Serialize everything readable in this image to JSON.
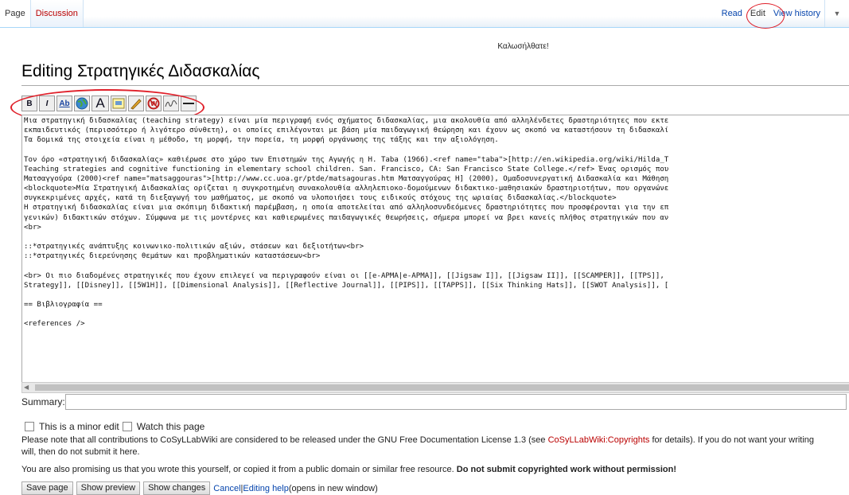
{
  "tabs": {
    "left": [
      "Page",
      "Discussion"
    ],
    "right": [
      "Read",
      "Edit",
      "View history"
    ]
  },
  "sitenotice": "Καλωσήλθατε!",
  "title": "Editing Στρατηγικές Διδασκαλίας",
  "toolbar": {
    "bold": "B",
    "italic": "I",
    "internal_link": "Ab",
    "headline": "A"
  },
  "editor_text": "Μια στρατηγική διδασκαλίας (teaching strategy) είναι μία περιγραφή ενός σχήματος διδασκαλίας, μια ακολουθία από αλληλένδετες δραστηριότητες που εκτε\nεκπαιδευτικός (περισσότερο ή λιγότερο σύνθετη), οι οποίες επιλέγονται με βάση μία παιδαγωγική θεώρηση και έχουν ως σκοπό να καταστήσουν τη διδασκαλί\nΤα δομικά της στοιχεία είναι η μέθοδο, τη μορφή, την πορεία, τη μορφή οργάνωσης της τάξης και την αξιολόγηση.\n\nΤον όρο «στρατηγική διδασκαλίας» καθιέρωσε στο χώρο των Επιστημών της Αγωγής η H. Taba (1966).<ref name=\"taba\">[http://en.wikipedia.org/wiki/Hilda_T\nTeaching strategies and cognitive functioning in elementary school children. San. Francisco, CA: San Francisco State College.</ref> Ένας ορισμός που\nΜατσαγγούρα (2000)<ref name=\"matsaggouras\">[http://www.cc.uoa.gr/ptde/matsagouras.htm Ματσαγγούρας Η] (2000), Ομαδοσυνεργατική Διδασκαλία και Μάθηση\n<blockquote>Μία Στρατηγική Διδασκαλίας ορίζεται η συγκροτημένη συνακολουθία αλληλεπιοκο-δομούμενων διδακτικο-μαθησιακών δραστηριοτήτων, που οργανώνε\nσυγκεκριμένες αρχές, κατά τη διεξαγωγή του μαθήματος, με σκοπό να υλοποιήσει τους ειδικούς στόχους της ωριαίας διδασκαλίας.</blockquote>\nΗ στρατηγική διδασκαλίας είναι μια σκόπιμη διδακτική παρέμβαση, η οποία αποτελείται από αλληλοσυνδεόμενες δραστηριότητες που προσφέρονται για την επ\nγενικών) διδακτικών στόχων. Σύμφωνα με τις μοντέρνες και καθιερωμένες παιδαγωγικές θεωρήσεις, σήμερα μπορεί να βρει κανείς πλήθος στρατηγικών που αν\n<br>\n\n::*στρατηγικές ανάπτυξης κοινωνικο-πολιτικών αξιών, στάσεων και δεξιοτήτων<br>\n::*στρατηγικές διερεύνησης θεμάτων και προβληματικών καταστάσεων<br>\n\n<br> Οι πιο διαδομένες στρατηγικές που έχουν επιλεγεί να περιγραφούν είναι οι [[e-APMA|e-APMA]], [[Jigsaw I]], [[Jigsaw II]], [[SCAMPER]], [[TPS]],\nStrategy]], [[Disney]], [[5W1H]], [[Dimensional Analysis]], [[Reflective Journal]], [[PIPS]], [[TAPPS]], [[Six Thinking Hats]], [[SWOT Analysis]], [\n\n== Βιβλιογραφία ==\n\n<references />",
  "summary_label": "Summary:",
  "summary_value": "",
  "minor_edit_label": "This is a minor edit",
  "watch_label": "Watch this page",
  "license_note": {
    "prefix": "Please note that all contributions to CoSyLLabWiki are considered to be released under the GNU Free Documentation License 1.3 (see ",
    "link": "CoSyLLabWiki:Copyrights",
    "suffix": " for details). If you do not want your writing",
    "line2": "will, then do not submit it here."
  },
  "promise_note": {
    "text": "You are also promising us that you wrote this yourself, or copied it from a public domain or similar free resource. ",
    "bold": "Do not submit copyrighted work without permission!"
  },
  "buttons": {
    "save": "Save page",
    "preview": "Show preview",
    "changes": "Show changes",
    "cancel": "Cancel",
    "separator": " | ",
    "help": "Editing help",
    "help_suffix": " (opens in new window)"
  },
  "colors": {
    "annotation": "#e0202a",
    "link": "#0645ad",
    "redlink": "#ba0000"
  }
}
